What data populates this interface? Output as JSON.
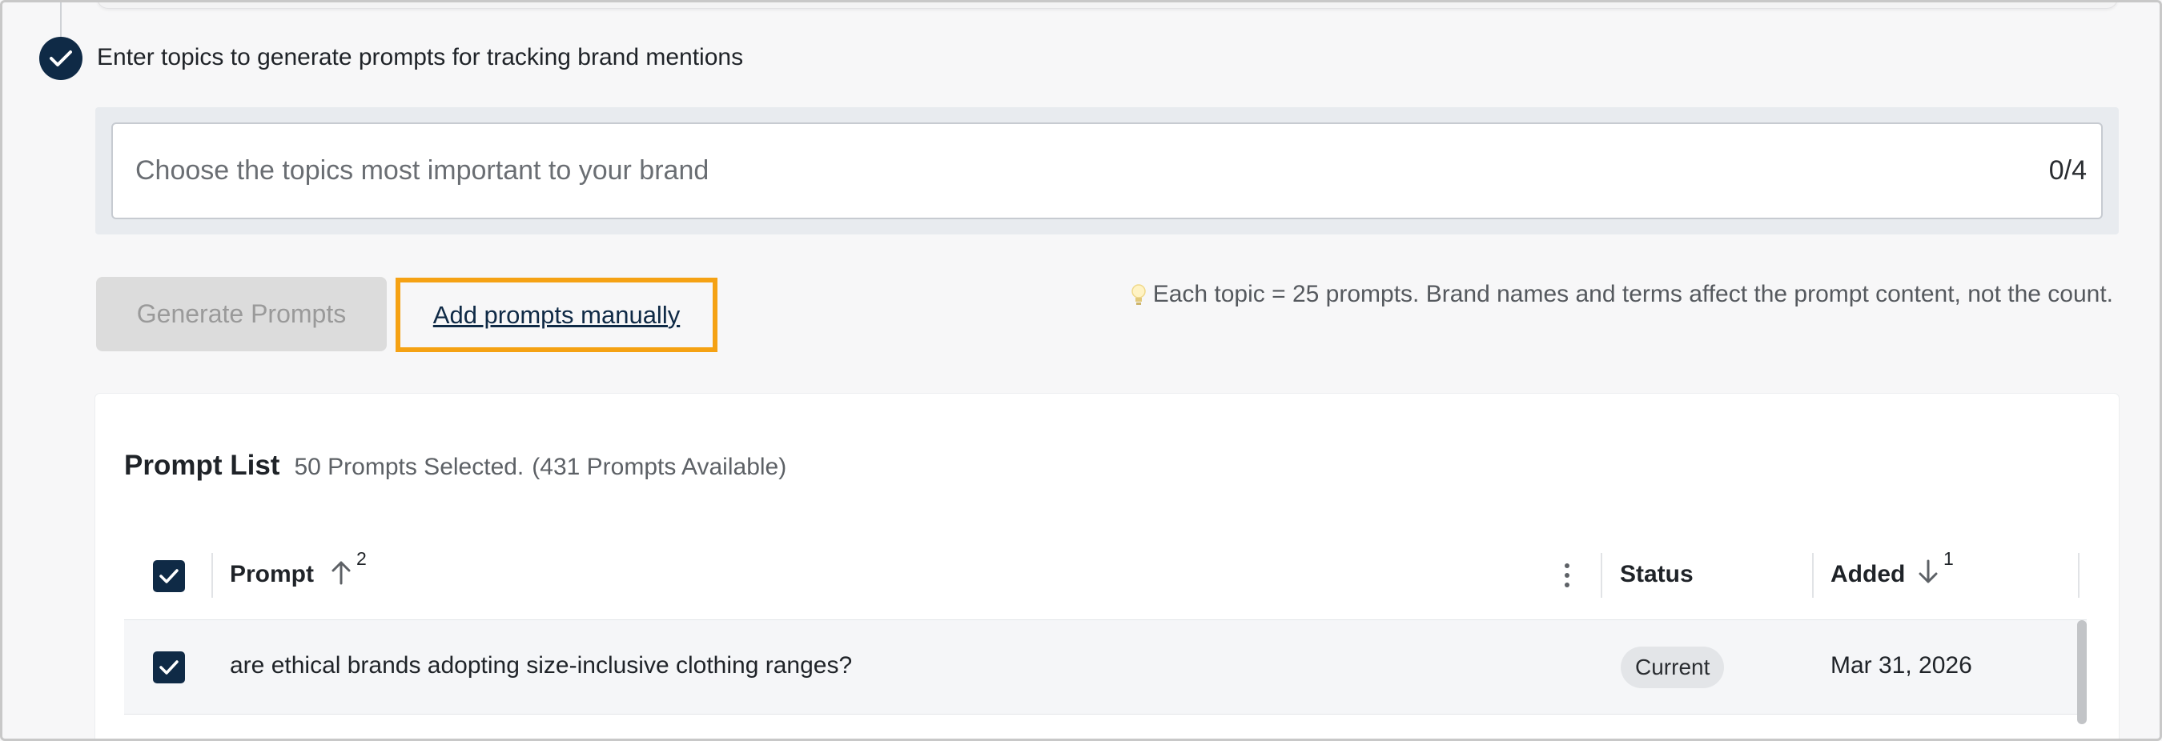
{
  "step": {
    "title": "Enter topics to generate prompts for tracking brand mentions"
  },
  "topics": {
    "placeholder": "Choose the topics most important to your brand",
    "value": "",
    "count": "0/4"
  },
  "actions": {
    "generate_label": "Generate Prompts",
    "add_manual_label": "Add prompts manually",
    "hint": "Each topic = 25 prompts. Brand names and terms affect the prompt content, not the count."
  },
  "prompt_list": {
    "title": "Prompt List",
    "selected": "50 Prompts Selected.",
    "available": "(431 Prompts Available)",
    "columns": {
      "prompt": "Prompt",
      "prompt_sort_rank": "2",
      "status": "Status",
      "added": "Added",
      "added_sort_rank": "1"
    },
    "rows": [
      {
        "prompt": "are ethical brands adopting size-inclusive clothing ranges?",
        "status": "Current",
        "added": "Mar 31, 2026",
        "checked": true
      }
    ]
  },
  "colors": {
    "brand_navy": "#0f2a46",
    "highlight_orange": "#f5a214",
    "disabled_gray": "#dcdcdc"
  }
}
